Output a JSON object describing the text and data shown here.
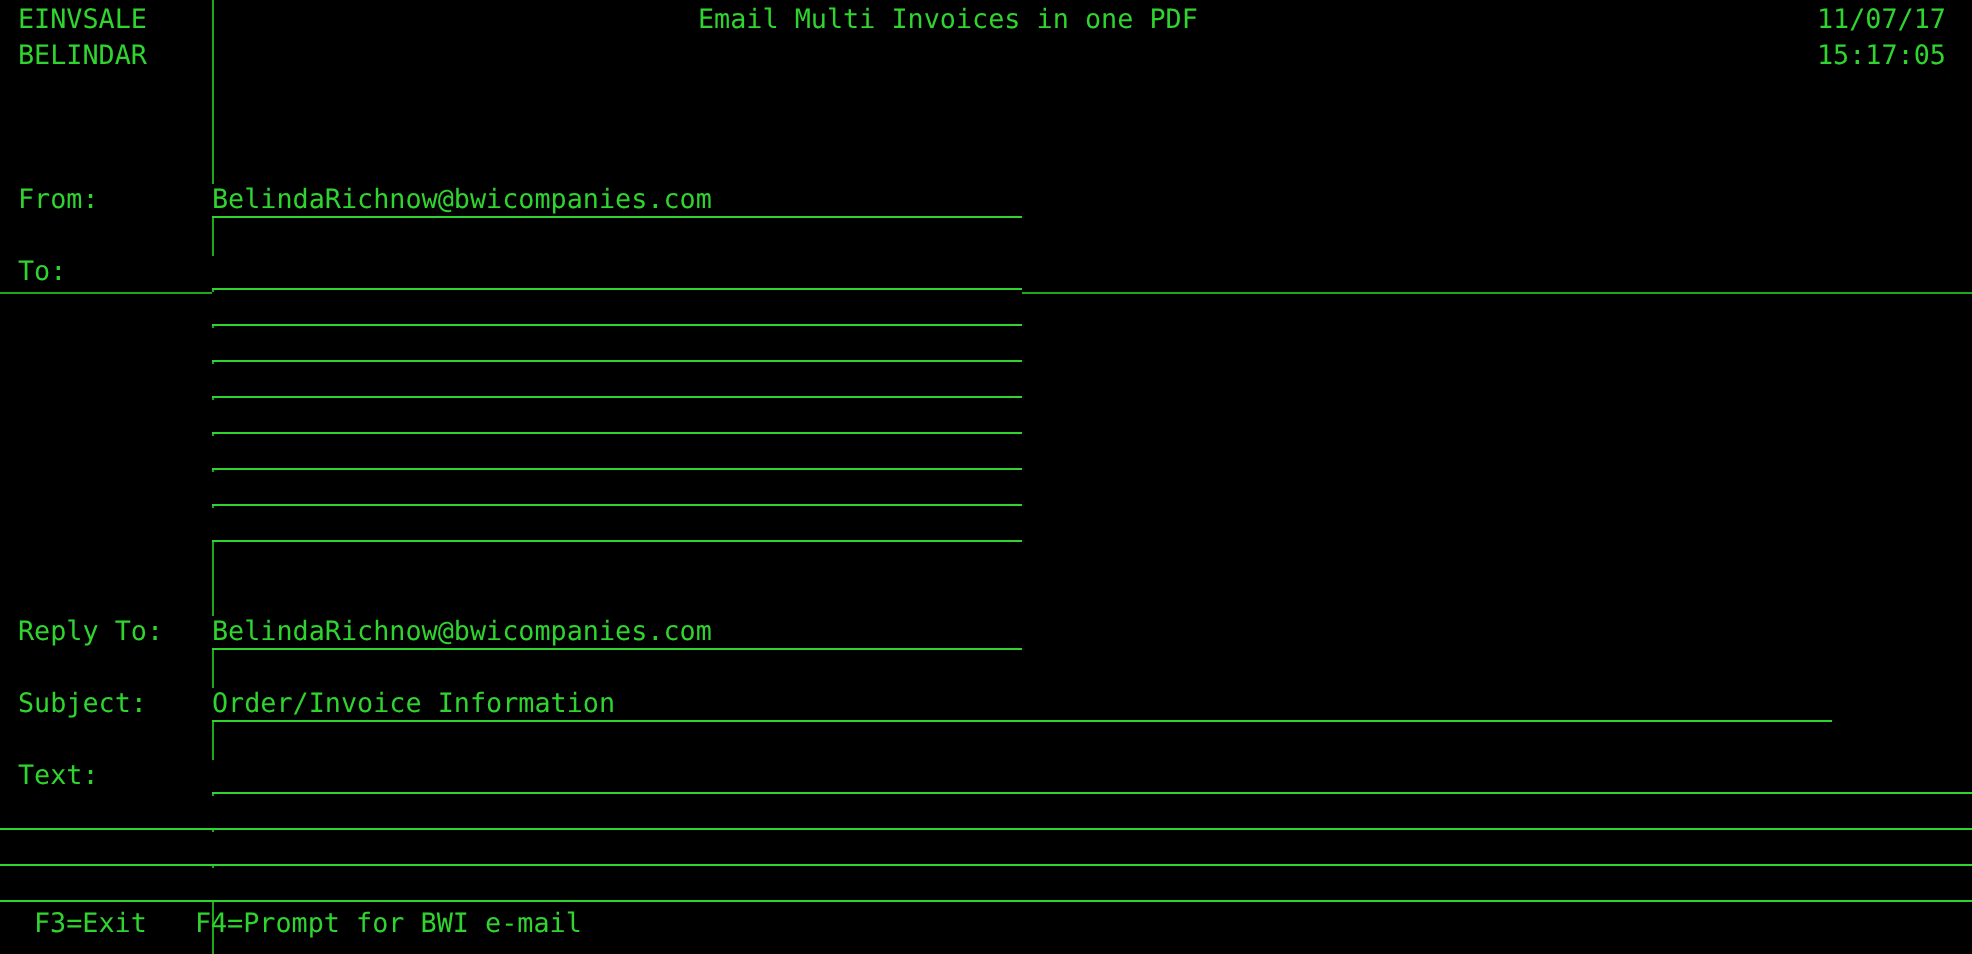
{
  "header": {
    "program": "EINVSALE",
    "user": "BELINDAR",
    "title": "Email Multi Invoices in one PDF",
    "date": "11/07/17",
    "time": "15:17:05"
  },
  "fields": [
    {
      "kind": "email",
      "label": "From:",
      "value": "BelindaRichnow@bwicompanies.com"
    },
    {
      "kind": "email_list",
      "label": "To:"
    },
    {
      "kind": "email",
      "label": "Reply To:",
      "value": "BelindaRichnow@bwicompanies.com"
    },
    {
      "kind": "subject",
      "label": "Subject:",
      "value": "Order/Invoice Information"
    },
    {
      "kind": "text",
      "label": "Text:"
    }
  ],
  "function_keys": [
    "F3=Exit",
    "F4=Prompt for BWI e-mail"
  ]
}
